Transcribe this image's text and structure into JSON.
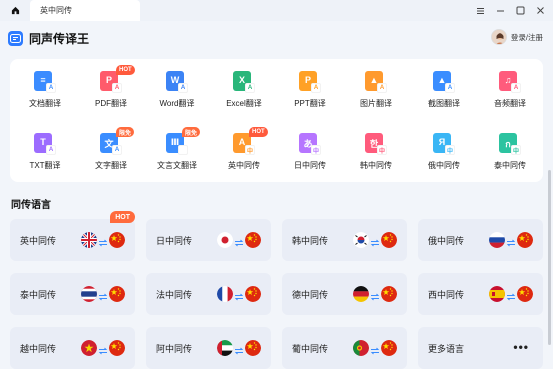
{
  "titlebar": {
    "tab_title": "英中同传",
    "home_icon": "home-icon",
    "controls": [
      "menu-icon",
      "minimize-icon",
      "maximize-icon",
      "close-icon"
    ]
  },
  "header": {
    "app_title": "同声传译王",
    "login_label": "登录/注册"
  },
  "tools": {
    "row1": [
      {
        "label": "文档翻译",
        "color": "#3b8cff",
        "glyph": "≡",
        "sub": "A"
      },
      {
        "label": "PDF翻译",
        "color": "#ff5b6b",
        "glyph": "P",
        "sub": "A",
        "badge": "HOT"
      },
      {
        "label": "Word翻译",
        "color": "#3c83f5",
        "glyph": "W",
        "sub": "A"
      },
      {
        "label": "Excel翻译",
        "color": "#29b67a",
        "glyph": "X",
        "sub": "A"
      },
      {
        "label": "PPT翻译",
        "color": "#ffa126",
        "glyph": "P",
        "sub": "A"
      },
      {
        "label": "图片翻译",
        "color": "#ff9a2e",
        "glyph": "▲",
        "sub": "A"
      },
      {
        "label": "截图翻译",
        "color": "#3a8dff",
        "glyph": "▲",
        "sub": "A"
      },
      {
        "label": "音频翻译",
        "color": "#ff5b7c",
        "glyph": "♫",
        "sub": "A"
      }
    ],
    "row2": [
      {
        "label": "TXT翻译",
        "color": "#9c6cff",
        "glyph": "T",
        "sub": "A"
      },
      {
        "label": "文字翻译",
        "color": "#3a8dff",
        "glyph": "文",
        "sub": "A",
        "badge": "限免"
      },
      {
        "label": "文言文翻译",
        "color": "#3a8dff",
        "glyph": "Ⅲ",
        "sub": "",
        "badge": "限免"
      },
      {
        "label": "英中同传",
        "color": "#ff9a2e",
        "glyph": "A",
        "sub": "中",
        "badge": "HOT"
      },
      {
        "label": "日中同传",
        "color": "#b675ff",
        "glyph": "あ",
        "sub": "中"
      },
      {
        "label": "韩中同传",
        "color": "#ff5b7c",
        "glyph": "한",
        "sub": "中"
      },
      {
        "label": "俄中同传",
        "color": "#3ab6f5",
        "glyph": "Я",
        "sub": "中"
      },
      {
        "label": "泰中同传",
        "color": "#2cc3a0",
        "glyph": "ก",
        "sub": "中"
      }
    ]
  },
  "section": {
    "title": "同传语言"
  },
  "languages": [
    {
      "label": "英中同传",
      "src_flag": "uk-flag-icon",
      "badge": "HOT"
    },
    {
      "label": "日中同传",
      "src_flag": "japan-flag-icon"
    },
    {
      "label": "韩中同传",
      "src_flag": "korea-flag-icon"
    },
    {
      "label": "俄中同传",
      "src_flag": "russia-flag-icon"
    },
    {
      "label": "泰中同传",
      "src_flag": "thailand-flag-icon"
    },
    {
      "label": "法中同传",
      "src_flag": "france-flag-icon"
    },
    {
      "label": "德中同传",
      "src_flag": "germany-flag-icon"
    },
    {
      "label": "西中同传",
      "src_flag": "spain-flag-icon"
    },
    {
      "label": "越中同传",
      "src_flag": "vietnam-flag-icon"
    },
    {
      "label": "阿中同传",
      "src_flag": "uae-flag-icon"
    },
    {
      "label": "葡中同传",
      "src_flag": "portugal-flag-icon"
    },
    {
      "label": "更多语言",
      "more": "•••"
    }
  ],
  "colors": {
    "accent": "#2d7bff",
    "hot": "#ff5a3c",
    "card_bg": "#e9edf6",
    "page_bg": "#f2f5fa"
  }
}
